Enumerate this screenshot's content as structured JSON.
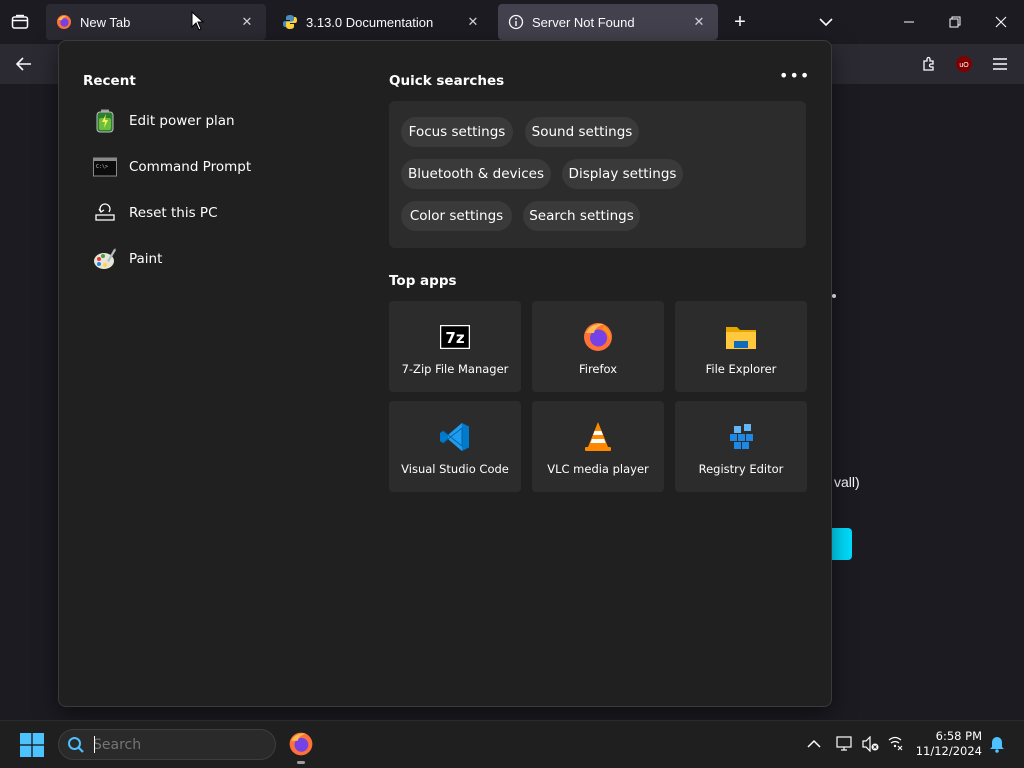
{
  "browser": {
    "tabs": [
      {
        "title": "New Tab",
        "icon": "firefox-icon"
      },
      {
        "title": "3.13.0 Documentation",
        "icon": "python-icon"
      },
      {
        "title": "Server Not Found",
        "icon": "info-icon"
      }
    ],
    "page_text_fragment": "vall)"
  },
  "start_menu": {
    "recent": {
      "title": "Recent",
      "items": [
        {
          "label": "Edit power plan",
          "icon": "battery-icon"
        },
        {
          "label": "Command Prompt",
          "icon": "terminal-icon"
        },
        {
          "label": "Reset this PC",
          "icon": "reset-pc-icon"
        },
        {
          "label": "Paint",
          "icon": "paint-icon"
        }
      ]
    },
    "quick_searches": {
      "title": "Quick searches",
      "chips": [
        "Focus settings",
        "Sound settings",
        "Bluetooth & devices",
        "Display settings",
        "Color settings",
        "Search settings"
      ]
    },
    "top_apps": {
      "title": "Top apps",
      "apps": [
        {
          "label": "7-Zip File Manager",
          "icon": "7zip-icon"
        },
        {
          "label": "Firefox",
          "icon": "firefox-icon"
        },
        {
          "label": "File Explorer",
          "icon": "folder-icon"
        },
        {
          "label": "Visual Studio Code",
          "icon": "vscode-icon"
        },
        {
          "label": "VLC media player",
          "icon": "vlc-icon"
        },
        {
          "label": "Registry Editor",
          "icon": "registry-icon"
        }
      ]
    }
  },
  "taskbar": {
    "search_placeholder": "Search",
    "time": "6:58 PM",
    "date": "11/12/2024"
  },
  "colors": {
    "accent": "#00ddff",
    "start_bg": "#202020",
    "tile_bg": "#2c2c2c",
    "chip_bg": "#3a3a3a"
  }
}
